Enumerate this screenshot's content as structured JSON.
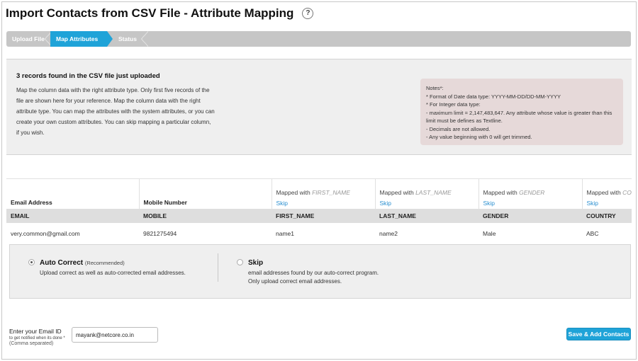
{
  "page": {
    "title": "Import Contacts from CSV File - Attribute Mapping",
    "help_glyph": "?"
  },
  "steps": [
    {
      "label": "Upload File",
      "active": false
    },
    {
      "label": "Map Attributes",
      "active": true
    },
    {
      "label": "Status",
      "active": false
    }
  ],
  "summary": {
    "heading": "3 records found in the CSV file just uploaded",
    "lines": [
      "Map the column data with the right attribute type. Only first five records of the",
      "file are shown here for your reference. Map the column data with the right",
      "attribute type. You can map the attributes with the system attributes, or you can",
      "create your own custom attributes. You can skip mapping a particular column,",
      "if you wish."
    ]
  },
  "notes": {
    "title": "Notes*:",
    "lines": [
      "* Format of Date data type: YYYY-MM-DD/DD-MM-YYYY",
      "* For Integer data type:",
      "- maximum limit = 2,147,483,647. Any attribute whose value is greater than this",
      "limit must be defines as Textline.",
      "- Decimals are not allowed.",
      "- Any value beginning with 0 will get trimmed."
    ]
  },
  "mapping": {
    "mapped_with_text": "Mapped with",
    "skip_label": "Skip",
    "columns": [
      {
        "label": "Email Address",
        "key": "EMAIL",
        "value": "very.common@gmail.com"
      },
      {
        "label": "Mobile Number",
        "key": "MOBILE",
        "value": "9821275494"
      },
      {
        "attr": "FIRST_NAME",
        "key": "FIRST_NAME",
        "value": "name1"
      },
      {
        "attr": "LAST_NAME",
        "key": "LAST_NAME",
        "value": "name2"
      },
      {
        "attr": "GENDER",
        "key": "GENDER",
        "value": "Male"
      },
      {
        "attr": "COUNTRY",
        "key": "COUNTRY",
        "value": "ABC"
      }
    ]
  },
  "correction": {
    "auto": {
      "title": "Auto Correct",
      "tag": "(Recommended)",
      "desc": "Upload correct as well as auto-corrected email addresses.",
      "selected": true
    },
    "skip": {
      "title": "Skip",
      "desc1": "email addresses found by our auto-correct program.",
      "desc2": "Only upload correct email addresses.",
      "selected": false
    }
  },
  "notify": {
    "label": "Enter your Email ID",
    "hint": "to get notified when its done *",
    "comma_note": "(Comma separated)",
    "value": "mayank@netcore.co.in"
  },
  "actions": {
    "save_label": "Save & Add Contacts"
  }
}
